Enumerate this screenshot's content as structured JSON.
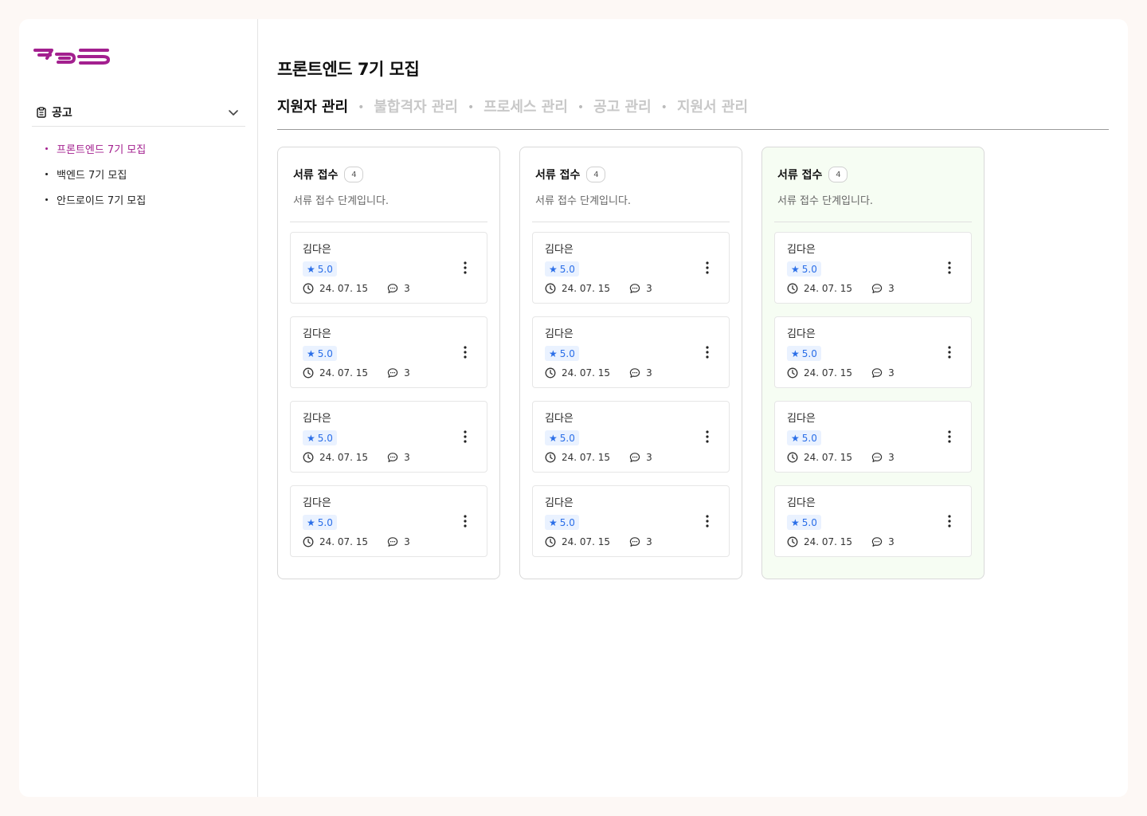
{
  "colors": {
    "accent": "#a3208f",
    "rating": "#2a6ee8",
    "rating_bg": "#eaf2ff",
    "green_column_bg": "#f6fdf3"
  },
  "sidebar": {
    "section_label": "공고",
    "items": [
      {
        "label": "프론트엔드 7기 모집",
        "active": true
      },
      {
        "label": "백엔드 7기 모집",
        "active": false
      },
      {
        "label": "안드로이드 7기 모집",
        "active": false
      }
    ]
  },
  "page": {
    "title": "프론트엔드 7기 모집",
    "tabs": [
      "지원자 관리",
      "불합격자 관리",
      "프로세스 관리",
      "공고 관리",
      "지원서 관리"
    ],
    "active_tab": 0
  },
  "columns": [
    {
      "title": "서류 접수",
      "count": "4",
      "description": "서류 접수 단계입니다.",
      "cards": [
        {
          "name": "김다은",
          "rating": "5.0",
          "date": "24. 07. 15",
          "comments": "3"
        },
        {
          "name": "김다은",
          "rating": "5.0",
          "date": "24. 07. 15",
          "comments": "3"
        },
        {
          "name": "김다은",
          "rating": "5.0",
          "date": "24. 07. 15",
          "comments": "3"
        },
        {
          "name": "김다은",
          "rating": "5.0",
          "date": "24. 07. 15",
          "comments": "3"
        }
      ]
    },
    {
      "title": "서류 접수",
      "count": "4",
      "description": "서류 접수 단계입니다.",
      "cards": [
        {
          "name": "김다은",
          "rating": "5.0",
          "date": "24. 07. 15",
          "comments": "3"
        },
        {
          "name": "김다은",
          "rating": "5.0",
          "date": "24. 07. 15",
          "comments": "3"
        },
        {
          "name": "김다은",
          "rating": "5.0",
          "date": "24. 07. 15",
          "comments": "3"
        },
        {
          "name": "김다은",
          "rating": "5.0",
          "date": "24. 07. 15",
          "comments": "3"
        }
      ]
    },
    {
      "title": "서류 접수",
      "count": "4",
      "description": "서류 접수 단계입니다.",
      "cards": [
        {
          "name": "김다은",
          "rating": "5.0",
          "date": "24. 07. 15",
          "comments": "3"
        },
        {
          "name": "김다은",
          "rating": "5.0",
          "date": "24. 07. 15",
          "comments": "3"
        },
        {
          "name": "김다은",
          "rating": "5.0",
          "date": "24. 07. 15",
          "comments": "3"
        },
        {
          "name": "김다은",
          "rating": "5.0",
          "date": "24. 07. 15",
          "comments": "3"
        }
      ]
    }
  ],
  "icons": {
    "logo": "crew-logo",
    "section": "clipboard-icon",
    "collapse": "chevron-down-icon",
    "rating": "star-icon",
    "date": "clock-icon",
    "comments": "comment-icon",
    "more": "more-vertical-icon"
  }
}
